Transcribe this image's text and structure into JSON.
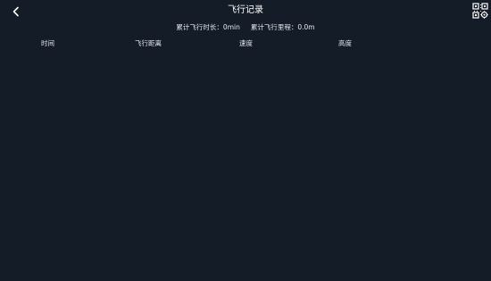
{
  "header": {
    "title": "飞行记录",
    "back_icon": "chevron-left-icon",
    "qr_icon": "qr-scan-icon"
  },
  "summary": {
    "total_duration": "累计飞行时长：0min",
    "total_distance": "累计飞行里程：0.0m"
  },
  "table": {
    "columns": [
      "时间",
      "飞行距离",
      "速度",
      "高度"
    ],
    "rows": []
  },
  "colors": {
    "background": "#141c28",
    "text": "#ffffff"
  }
}
